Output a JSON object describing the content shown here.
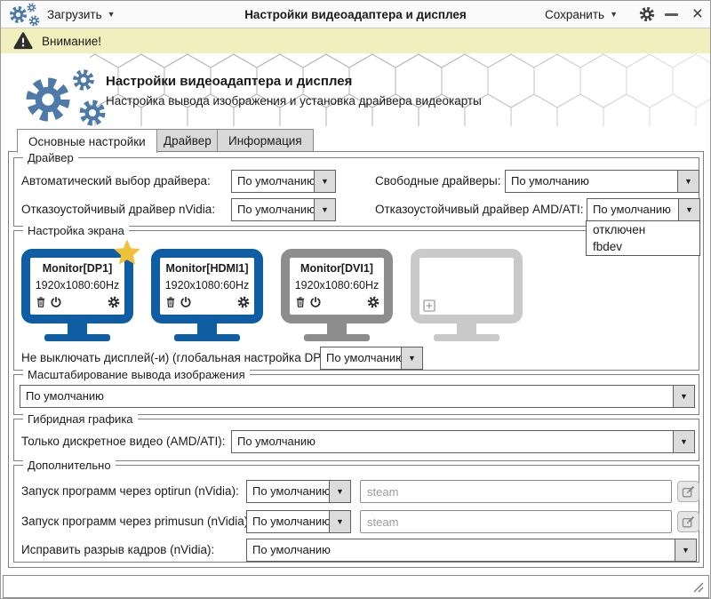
{
  "titlebar": {
    "load_label": "Загрузить",
    "title": "Настройки видеоадаптера и дисплея",
    "save_label": "Сохранить"
  },
  "warning": {
    "text": "Внимание!"
  },
  "header": {
    "title": "Настройки видеоадаптера и дисплея",
    "subtitle": "Настройка вывода изображения и установка драйвера видеокарты"
  },
  "tabs": [
    {
      "label": "Основные настройки",
      "active": true
    },
    {
      "label": "Драйвер",
      "active": false
    },
    {
      "label": "Информация",
      "active": false
    }
  ],
  "groups": {
    "driver": {
      "legend": "Драйвер",
      "auto_label": "Автоматический выбор драйвера:",
      "auto_value": "По умолчанию",
      "free_label": "Свободные драйверы:",
      "free_value": "По умолчанию",
      "nvidia_label": "Отказоустойчивый драйвер nVidia:",
      "nvidia_value": "По умолчанию",
      "amd_label": "Отказоустойчивый драйвер AMD/ATI:",
      "amd_value": "По умолчанию",
      "amd_options": [
        "отключен",
        "fbdev"
      ]
    },
    "screen": {
      "legend": "Настройка экрана",
      "monitors": [
        {
          "name": "Monitor[DP1]",
          "mode": "1920x1080:60Hz",
          "state": "primary"
        },
        {
          "name": "Monitor[HDMI1]",
          "mode": "1920x1080:60Hz",
          "state": "active"
        },
        {
          "name": "Monitor[DVI1]",
          "mode": "1920x1080:60Hz",
          "state": "connected"
        },
        {
          "name": "",
          "mode": "",
          "state": "empty"
        }
      ],
      "dpms_label": "Не выключать дисплей(-и) (глобальная настройка DPMS):",
      "dpms_value": "По умолчанию"
    },
    "scaling": {
      "legend": "Масштабирование вывода изображения",
      "value": "По умолчанию"
    },
    "hybrid": {
      "legend": "Гибридная графика",
      "label": "Только дискретное видео (AMD/ATI):",
      "value": "По умолчанию"
    },
    "advanced": {
      "legend": "Дополнительно",
      "optirun_label": "Запуск программ через optirun (nVidia):",
      "optirun_value": "По умолчанию",
      "optirun_placeholder": "steam",
      "primusun_label": "Запуск программ через primusun (nVidia):",
      "primusun_value": "По умолчанию",
      "primusun_placeholder": "steam",
      "tearing_label": "Исправить разрыв кадров (nVidia):",
      "tearing_value": "По умолчанию"
    }
  },
  "colors": {
    "accent_blue": "#0f5da2",
    "logo_blue": "#4d7aa9",
    "monitor_gray": "#8d8d8d",
    "monitor_light_gray": "#c9c9c9",
    "star_gold": "#f0c23c",
    "warning_bg": "#f1efbd"
  }
}
